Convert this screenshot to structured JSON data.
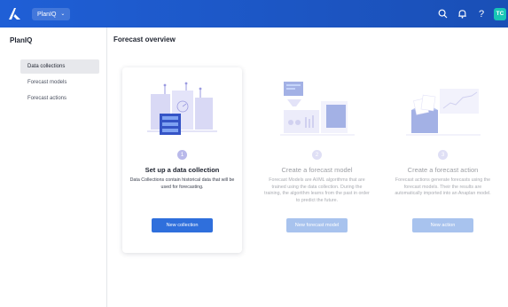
{
  "header": {
    "app_name": "PlanIQ",
    "search_icon": "search-icon",
    "notifications_icon": "bell-icon",
    "help_label": "?",
    "avatar_initials": "TC",
    "colors": {
      "bar": "#1f5fd6",
      "avatar": "#18c6b5"
    }
  },
  "sidebar": {
    "title": "PlanIQ",
    "items": [
      {
        "label": "Data collections",
        "active": true
      },
      {
        "label": "Forecast models",
        "active": false
      },
      {
        "label": "Forecast actions",
        "active": false
      }
    ]
  },
  "main": {
    "title": "Forecast overview",
    "cards": [
      {
        "step": "1",
        "title": "Set up a data collection",
        "description": "Data Collections contain historical data that will be used for forecasting.",
        "button": "New collection",
        "enabled": true
      },
      {
        "step": "2",
        "title": "Create a forecast model",
        "description": "Forecast Models are AI/ML algorithms that are trained using the data collection. During the training, the algorithm learns from the past in order to predict the future.",
        "button": "New forecast model",
        "enabled": false
      },
      {
        "step": "3",
        "title": "Create a forecast action",
        "description": "Forecast actions generate forecasts using the forecast models. Their the results are automatically imported into an Anaplan model.",
        "button": "New action",
        "enabled": false
      }
    ],
    "colors": {
      "primary_button": "#2f6fdc",
      "disabled_button": "#a8c3ee",
      "illustration": "#b9b9ea"
    }
  }
}
